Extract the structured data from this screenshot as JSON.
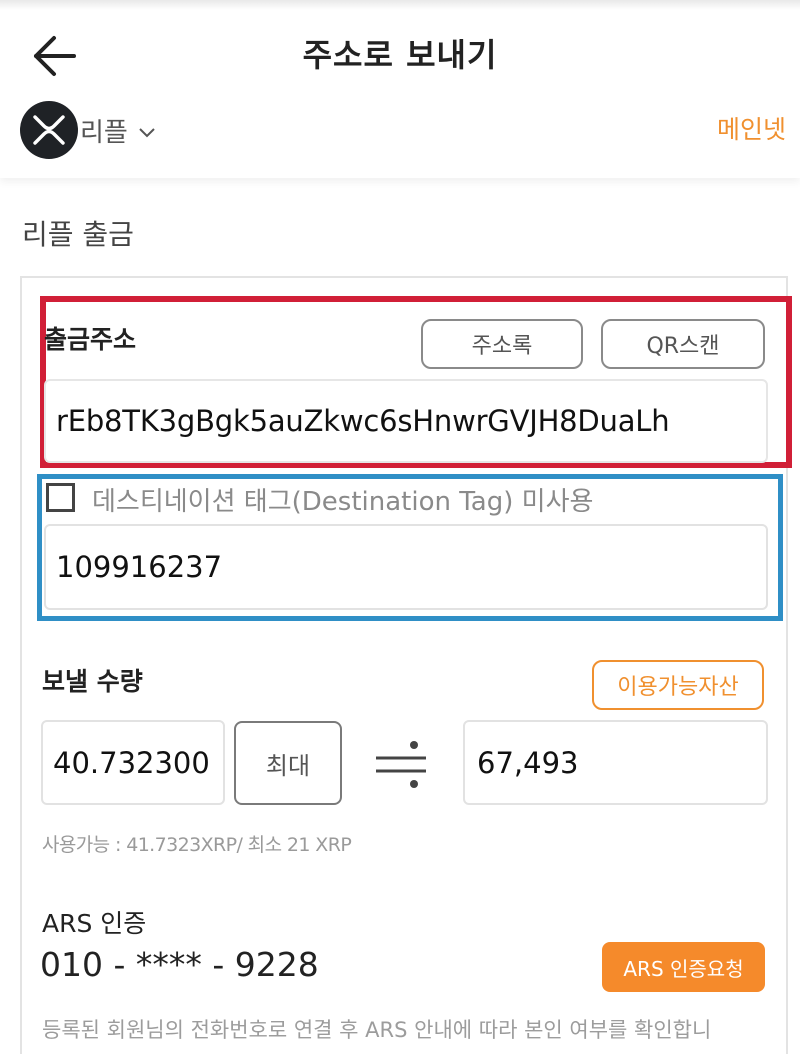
{
  "header": {
    "title": "주소로 보내기",
    "coin_name": "리플",
    "network": "메인넷"
  },
  "section_title": "리플 출금",
  "withdraw_address": {
    "label": "출금주소",
    "address_book_button": "주소록",
    "qr_scan_button": "QR스캔",
    "value": "rEb8TK3gBgk5auZkwc6sHnwrGVJH8DuaLh"
  },
  "destination_tag": {
    "checkbox_label": "데스티네이션 태그(Destination Tag) 미사용",
    "checked": false,
    "value": "109916237"
  },
  "amount": {
    "label": "보낼 수량",
    "available_assets_button": "이용가능자산",
    "value": "40.732300",
    "max_button": "최대",
    "converted_value": "67,493",
    "available_info": "사용가능 : 41.7323XRP/ 최소 21 XRP"
  },
  "ars": {
    "title": "ARS 인증",
    "phone": "010 - **** - 9228",
    "request_button": "ARS 인증요청",
    "description": "등록된 회원님의 전화번호로 연결 후 ARS 안내에 따라 본인 여부를 확인합니"
  },
  "icons": {
    "back": "arrow-left-icon",
    "coin": "xrp-logo-icon",
    "dropdown": "chevron-down-icon",
    "approx": "approximately-equal-icon"
  },
  "colors": {
    "accent_orange": "#f58a2b",
    "highlight_red": "#d11f37",
    "highlight_blue": "#2f8fc6"
  }
}
